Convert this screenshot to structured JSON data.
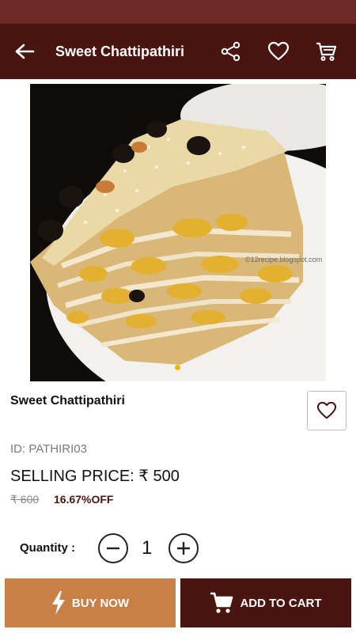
{
  "app_bar": {
    "title": "Sweet Chattipathiri",
    "icons": [
      "back-arrow-icon",
      "share-icon",
      "heart-icon",
      "cart-icon"
    ]
  },
  "product": {
    "image_watermark": "©12recipe.blogspot.com",
    "name": "Sweet Chattipathiri",
    "id_text": "ID: PATHIRI03",
    "selling_price": "SELLING PRICE: ₹ 500",
    "mrp": "₹ 600",
    "discount": "16.67%OFF"
  },
  "quantity": {
    "label": "Quantity :",
    "value": "1"
  },
  "actions": {
    "buy_now": "BUY NOW",
    "add_to_cart": "ADD TO CART"
  },
  "colors": {
    "status_bar": "#6b2a24",
    "app_bar": "#4a1410",
    "buy_now": "#c98047",
    "add_to_cart": "#4a1410",
    "carousel_dot": "#f0b800"
  }
}
